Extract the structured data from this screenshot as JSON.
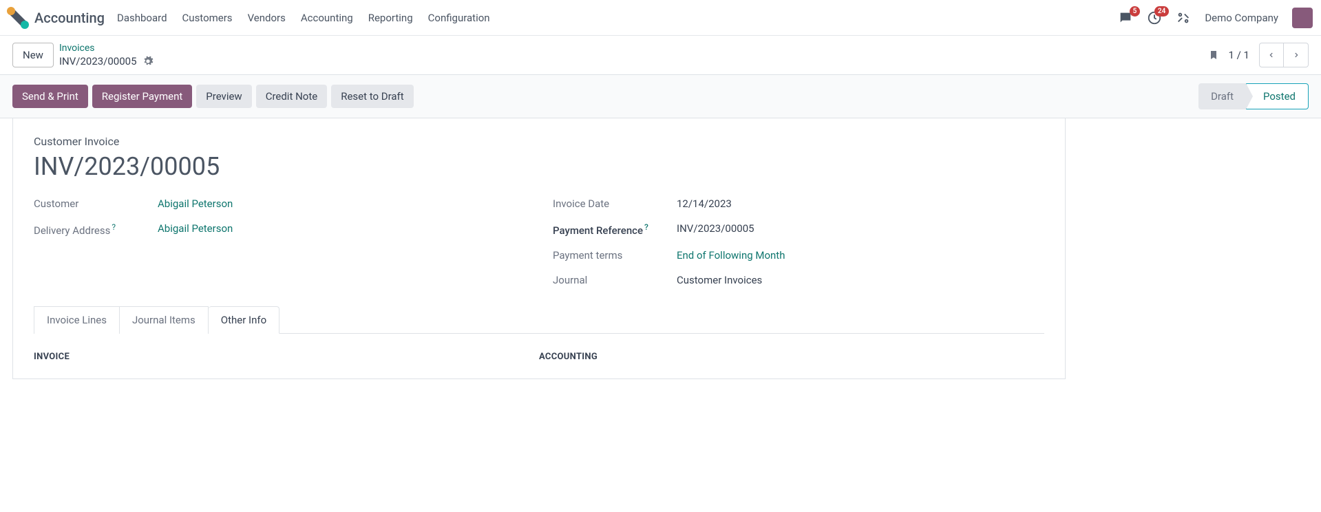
{
  "nav": {
    "brand": "Accounting",
    "items": [
      "Dashboard",
      "Customers",
      "Vendors",
      "Accounting",
      "Reporting",
      "Configuration"
    ],
    "messages_badge": "5",
    "activities_badge": "24",
    "company": "Demo Company"
  },
  "crumb": {
    "new_btn": "New",
    "parent": "Invoices",
    "current": "INV/2023/00005",
    "pager": "1 / 1"
  },
  "actions": {
    "send_print": "Send & Print",
    "register_payment": "Register Payment",
    "preview": "Preview",
    "credit_note": "Credit Note",
    "reset_draft": "Reset to Draft"
  },
  "status": {
    "draft": "Draft",
    "posted": "Posted"
  },
  "doc": {
    "type": "Customer Invoice",
    "name": "INV/2023/00005",
    "left": {
      "customer_label": "Customer",
      "customer_value": "Abigail Peterson",
      "delivery_label": "Delivery Address",
      "delivery_value": "Abigail Peterson"
    },
    "right": {
      "invoice_date_label": "Invoice Date",
      "invoice_date_value": "12/14/2023",
      "payment_ref_label": "Payment Reference",
      "payment_ref_value": "INV/2023/00005",
      "payment_terms_label": "Payment terms",
      "payment_terms_value": "End of Following Month",
      "journal_label": "Journal",
      "journal_value": "Customer Invoices"
    }
  },
  "tabs": {
    "invoice_lines": "Invoice Lines",
    "journal_items": "Journal Items",
    "other_info": "Other Info"
  },
  "sections": {
    "invoice": "INVOICE",
    "accounting": "ACCOUNTING"
  }
}
